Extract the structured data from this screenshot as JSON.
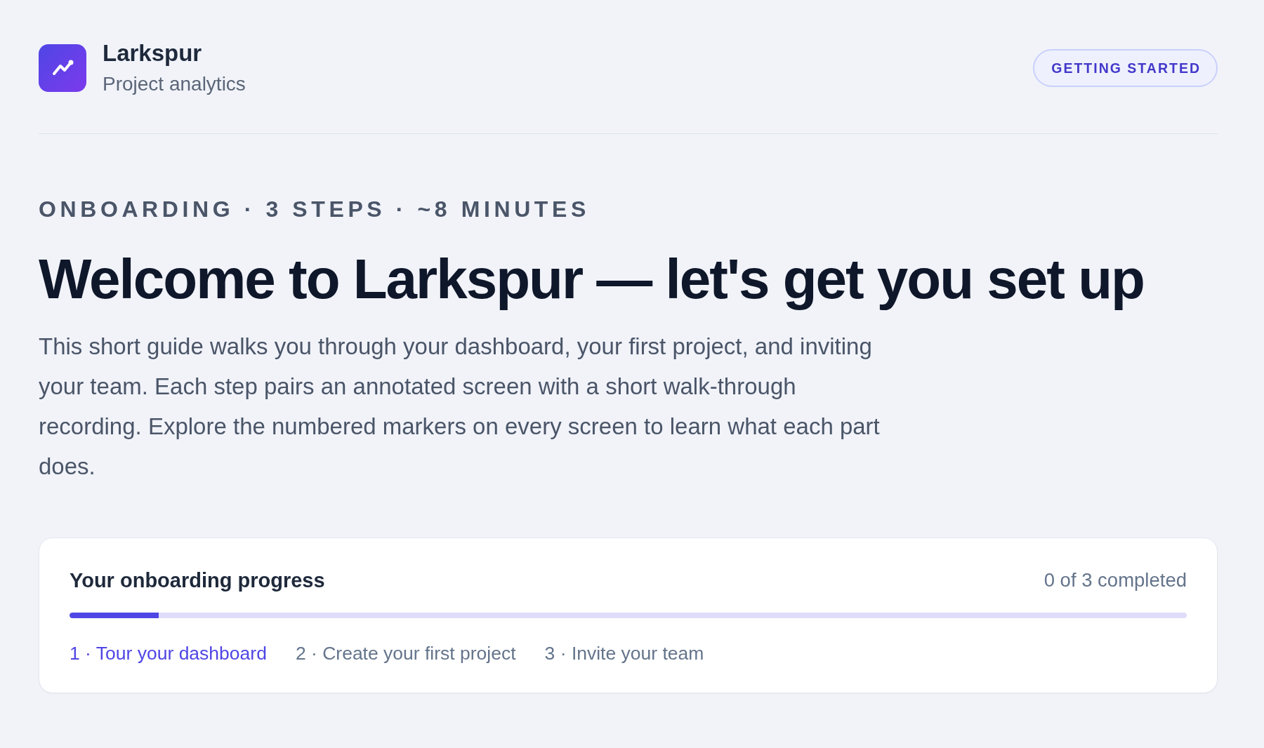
{
  "brand": {
    "name": "Larkspur",
    "tagline": "Project analytics"
  },
  "badge": "GETTING STARTED",
  "eyebrow": "ONBOARDING · 3 STEPS · ~8 MINUTES",
  "headline": "Welcome to Larkspur — let's get you set up",
  "intro": "This short guide walks you through your dashboard, your first project, and inviting your team. Each step pairs an annotated screen with a short walk-through recording. Explore the numbered markers on every screen to learn what each part does.",
  "progress": {
    "title": "Your onboarding progress",
    "summary": "0 of 3 completed",
    "level": 0.08,
    "steps": [
      {
        "label": "1 · Tour your dashboard",
        "selected": true
      },
      {
        "label": "2 · Create your first project",
        "selected": false
      },
      {
        "label": "3 · Invite your team",
        "selected": false
      }
    ]
  }
}
